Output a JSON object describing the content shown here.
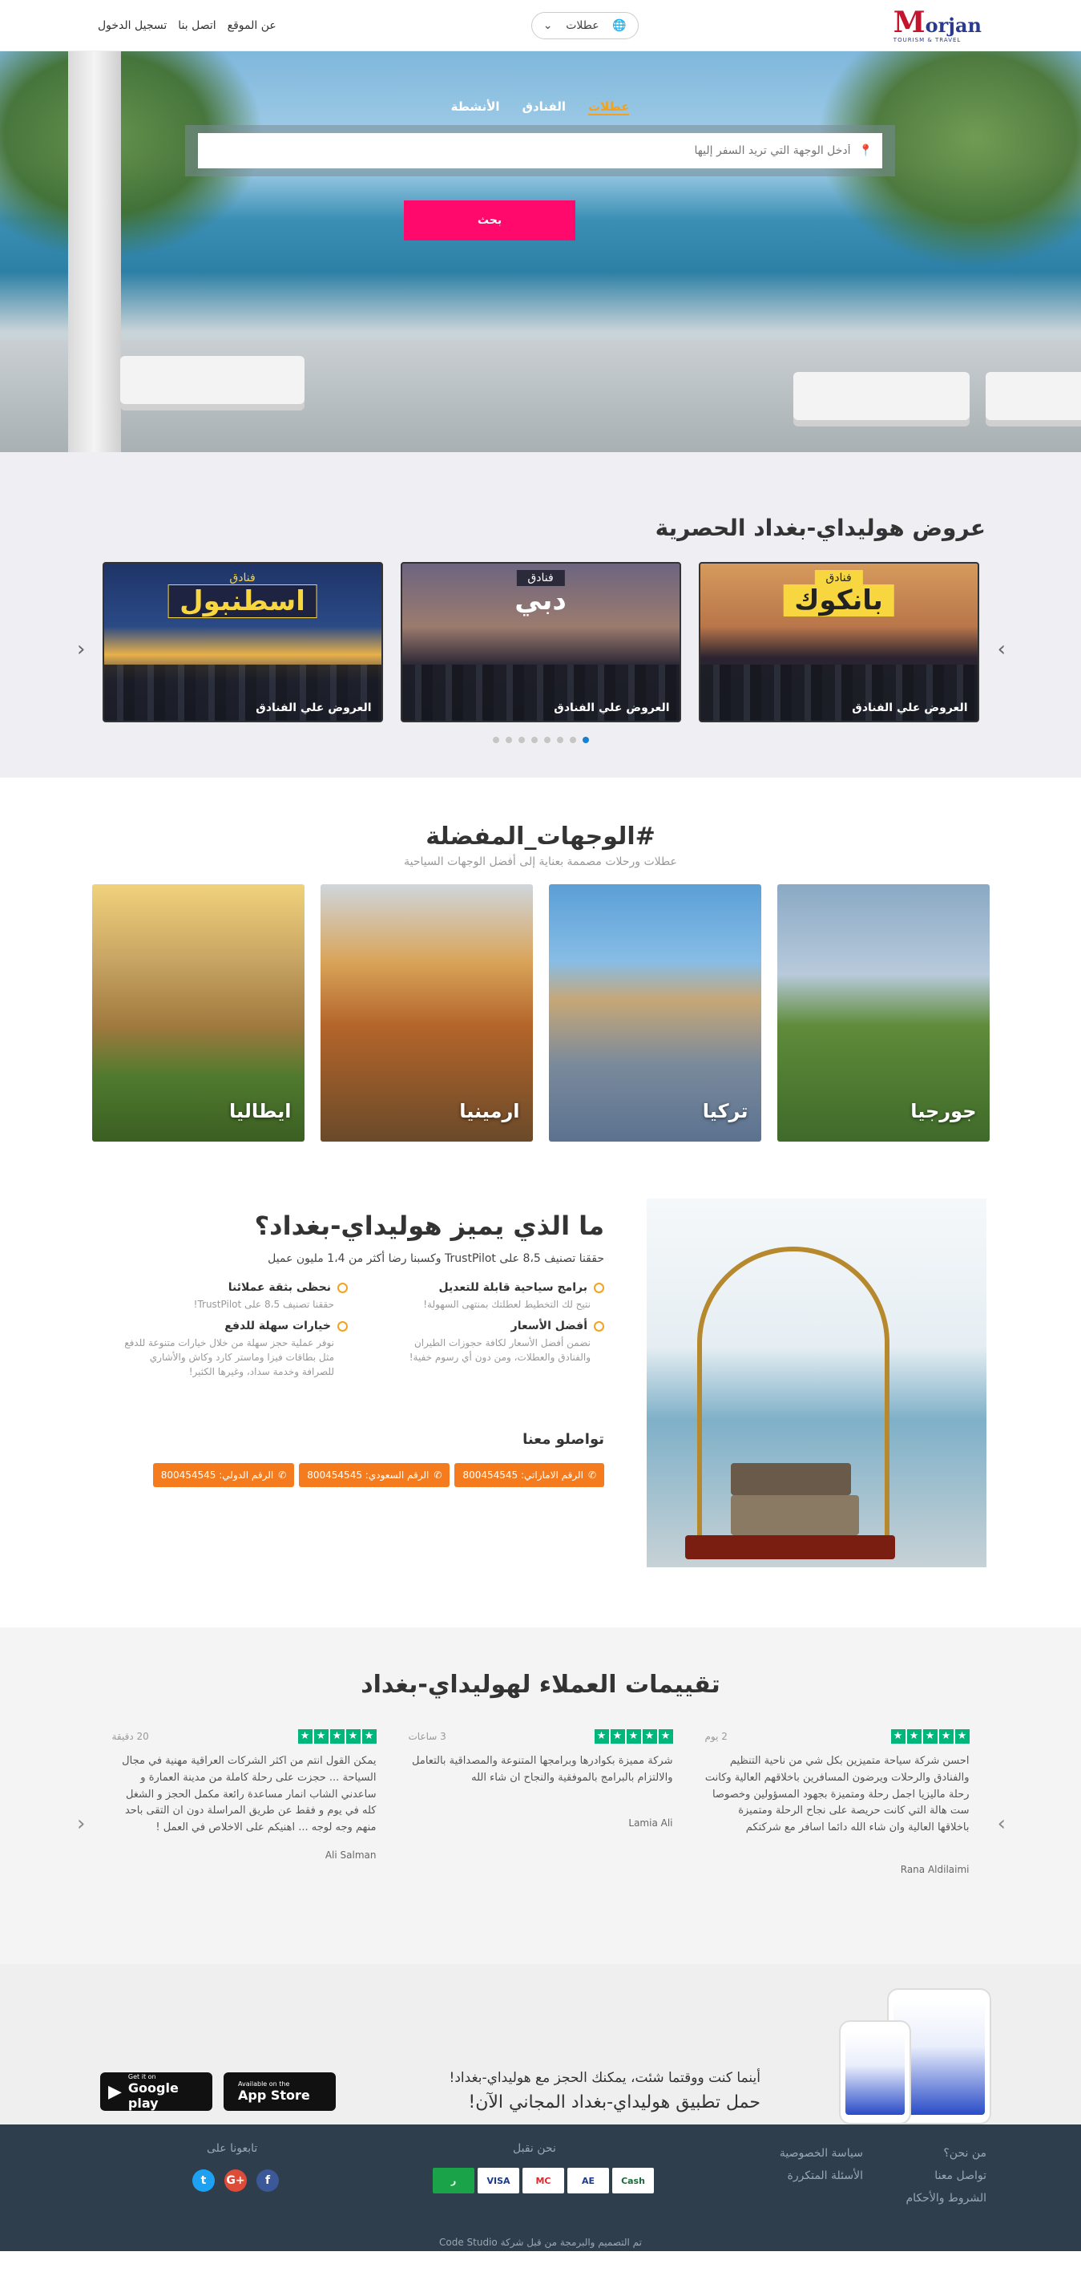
{
  "header": {
    "logo_m": "M",
    "logo_name": "orjan",
    "logo_tagline": "TOURISM & TRAVEL",
    "lang_label": "عطلات",
    "nav": [
      "عن الموقع",
      "اتصل بنا",
      "تسجيل الدخول"
    ]
  },
  "hero": {
    "tabs": [
      "عطلات",
      "الفنادق",
      "الأنشطة"
    ],
    "search_placeholder": "أدخل الوجهة التي تريد السفر إليها",
    "search_button": "بحث"
  },
  "offers": {
    "title": "عروض هوليداي-بغداد الحصرية",
    "cards": [
      {
        "tag": "فنادق",
        "city": "بانكوك",
        "caption": "العروض علي الفنادق"
      },
      {
        "tag": "فنادق",
        "city": "دبي",
        "caption": "العروض علي الفنادق"
      },
      {
        "tag": "فنادق",
        "city": "اسطنبول",
        "caption": "العروض علي الفنادق"
      }
    ],
    "dots": 8,
    "active_dot": 0
  },
  "destinations": {
    "title": "#الوجهات_المفضلة",
    "subtitle": "عطلات ورحلات مصممة بعناية إلى أفضل الوجهات السياحية",
    "items": [
      "جورجيا",
      "تركيا",
      "ارمينيا",
      "ايطاليا"
    ]
  },
  "why": {
    "title": "ما الذي يميز هوليداي-بغداد؟",
    "subtitle": "حققنا تصنيف 8،5 على TrustPilot وكسبنا رضا أكثر من 1،4 مليون عميل",
    "features": [
      {
        "title": "برامج سياحية قابلة للتعديل",
        "text": "نتيح لك التخطيط لعطلتك بمنتهى السهولة!"
      },
      {
        "title": "نحظى بثقة عملائنا",
        "text": "حققنا تصنيف 8،5 على TrustPilot!"
      },
      {
        "title": "أفضل الأسعار",
        "text": "نضمن أفضل الأسعار لكافة حجوزات الطيران والفنادق والعطلات، ومن دون أي رسوم خفية!"
      },
      {
        "title": "خيارات سهلة للدفع",
        "text": "نوفر عملية حجز سهلة من خلال خيارات متنوعة للدفع مثل بطاقات فيزا وماستر كارد وكاش والأشاري للصرافة وخدمة سداد، وغيرها الكثير!"
      }
    ],
    "contact_title": "تواصلو معنا",
    "phones": [
      "الرقم الاماراتي: 800454545",
      "الرقم السعودي: 800454545",
      "الرقم الدولي: 800454545"
    ]
  },
  "reviews": {
    "title": "تقييمات العملاء لهوليداي-بغداد",
    "items": [
      {
        "time": "2 يوم",
        "body": "احسن شركة سياحة متميزين بكل شي من ناحية التنظيم والفنادق والرحلات ويرضون المسافرين باخلاقهم العالية وكانت رحلة ماليزيا اجمل رحلة ومتميزة بجهود المسؤولين وخصوصا ست هالة التي كانت حريصة على نجاح الرحلة ومتميزة باخلاقها العالية وان شاء الله دائما اسافر مع شركتكم",
        "author": "Rana Aldilaimi"
      },
      {
        "time": "3 ساعات",
        "body": "شركة مميزة بكوادرها وبرامجها المتنوعة والمصداقية بالتعامل والالتزام بالبرامج بالموفقية والنجاح ان شاء الله",
        "author": "Lamia Ali"
      },
      {
        "time": "20 دقيقة",
        "body": "يمكن القول انتم من اكثر الشركات العراقية مهنية في مجال السياحة ... حجزت على رحلة كاملة من مدينة العمارة و ساعدني الشاب انمار مساعدة رائعة مكمل الحجز و الشغل كله في يوم و فقط عن طريق المراسلة دون ان التقى باحد منهم وجه لوجه ... اهنيكم على الاخلاص في العمل !",
        "author": "Ali Salman"
      }
    ]
  },
  "app": {
    "line1": "أينما كنت ووقتما شئت، يمكنك الحجز مع هوليداي-بغداد!",
    "line2": "حمل تطبيق هوليداي-بغداد المجاني الآن!",
    "google_small": "Get it on",
    "google_big": "Google play",
    "apple_small": "Available on the",
    "apple_big": "App Store"
  },
  "footer": {
    "col1": [
      "من نحن؟",
      "تواصل معنا",
      "الشروط والأحكام"
    ],
    "col2": [
      "سياسة الخصوصية",
      "الأسئلة المتكررة"
    ],
    "pay_title": "نحن نقبل",
    "payments": [
      "ر",
      "VISA",
      "MC",
      "AE",
      "Cash"
    ],
    "follow_title": "تابعونا على",
    "credit": "تم التصميم والبرمجة من قبل شركة Code Studio"
  },
  "colors": {
    "accent": "#ff0a6c",
    "orange": "#f57c1e",
    "trustpilot": "#00b67a",
    "footer": "#2f3e4c"
  }
}
